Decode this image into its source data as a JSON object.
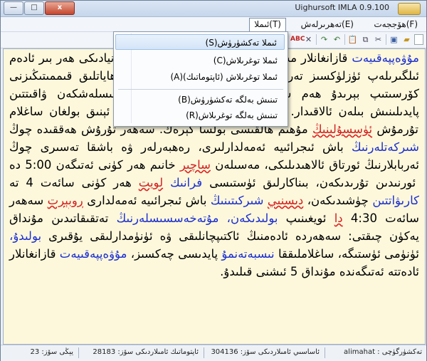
{
  "window": {
    "title": "Uighursoft IMLA 0.9.100",
    "buttons": {
      "minimize": "—",
      "maximize": "□",
      "close": "x"
    }
  },
  "menu": [
    {
      "label": "ھۆججەت(F)"
    },
    {
      "label": "تەھرىرلەش(E)"
    },
    {
      "label": "ئىملا(T)"
    }
  ],
  "dropdown": {
    "items": [
      "ئىملا تەكشۈرۈش(S)",
      "ئىملا توغرىلاش(C)",
      "ئىملا توغرىلاش (ئاپتوماتىك)(A)",
      "تىنىش بەلگە تەكشۈرۈش(B)",
      "تىنىش بەلگە توغرىلاش(R)"
    ]
  },
  "toolbar": {
    "icons": [
      "new-file-icon",
      "open-folder-icon",
      "save-icon",
      "cut-icon",
      "copy-icon",
      "paste-icon",
      "undo-icon",
      "redo-icon",
      "spellcheck-icon",
      "delete-icon"
    ]
  },
  "editor": {
    "line1": {
      "prefix": "قازانغانلار ",
      "word": "مۇۋەپپەقىيەت",
      "suffix": ""
    },
    "line2": {
      "a": "مەيلى خالاڭ ياكى خالىمىسىڭىز، بۇ دۇنيادىكى ھەر بىر ئادەم ئىلگىرىلەپ ئۈزلۈكسىز تەرەققىي قىلىۋاتقان ئادەم، سىزنىڭ ھاياتلىق قىممىتىڭىزنى كۆرسىتىپ بېرىدۇ ھەم سىزنىڭ ھاياتلىقىڭىزنى مۇتەخەسسىسلەشكەن ۋاقىتتىن پايدىلىنىش بىلەن ئالاقىدار. بۇ مەقسەتكە يېتىشتە دەل ۋاقىت ئېنىق بولغان ساغلام تۇرمۇش "
    },
    "w_tursun": "ئۈسسۇلىنىڭ",
    "line3": " مۇھىم ھالقىسى بولسا كېرەك. سەھەر تۇرۇش ھەققىدە چوڭ ",
    "w_sherket": "شىركەتلەرنىڭ",
    "line4": " باش ئىجرائىيە ئەمەلدارلىرى، رەھبەرلەر ۋە باشقا تەسىرى چوڭ ئەربابلارنىڭ ئورتاق ئالاھىدىلىكى، مەسىلەن ",
    "w_sacher": "ساچىر",
    "line5": " خانىم ھەر كۈنى ئەتىگەن 5:00 دە ئورنىدىن تۇرىدىكەن، بىناكارلىق ئۈستىسى ",
    "w_frank": "فرانىك",
    "w_loyet": "لويت",
    "line6": " ھەر كۈنى سائەت 4 تە ",
    "w_karwat": "كارىۋاتتىن",
    "line7": " چۈشىدىكەن، ",
    "w_disni": "دىسنىي",
    "w_sherket2": "شىركىتىنىڭ",
    "line8": " باش ئىجرائىيە ئەمەلدارى ",
    "w_robert": "روبېرت",
    "line9": " سەھەر سائەت 4:30 ",
    "w_da": "دا",
    "line10": " ئويغىنىپ ",
    "w_boldiken": "بولىدىكەن،",
    "w_mutexessis": "مۇتەخەسسىسلەرنىڭ",
    "line11": " تەتقىقاتىدىن مۇنداق يەكۈن چىقتى: سەھەردە ئادەمنىڭ ئاكتىپچانلىقى ۋە ئۈنۈمدارلىقى يۇقىرى ",
    "w_bolidu": "بولىدۇ،",
    "line12": " ئۈنۈمى ئۈستىگە، ساغلاملىققا ",
    "w_nisbeten": "نىسبەتەنمۇ",
    "line13": " پايدىسى چەكسىز، ",
    "w_muwepp2": "مۇۋەپپەقىيەت",
    "line14": " قازانغانلار ئادەتتە ئەتىگەندە مۇنداق 5 ئىشنى قىلىدۇ."
  },
  "status": {
    "checker": "تەكشۈرگۈچى : alimahat",
    "total": "ئاساسىي ئامىلاردىكى سۆز: 304136",
    "auto": "ئاپتوماتىك ئامىلاردىكى سۆز: 28183",
    "new": "يېڭى سۆز: 23"
  }
}
